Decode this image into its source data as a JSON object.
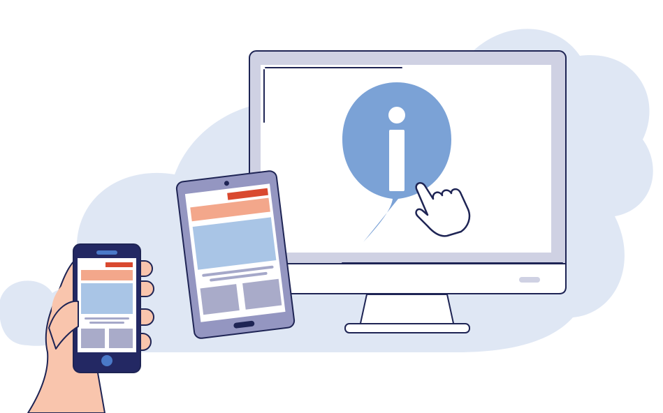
{
  "illustration": {
    "colors": {
      "cloud": "#dfe7f4",
      "outline": "#1e2454",
      "monitor_frame": "#cfd1e3",
      "screen": "#ffffff",
      "info_bubble": "#7ba2d6",
      "tablet_frame": "#9496c1",
      "phone_frame": "#232863",
      "header_red": "#d9492f",
      "header_orange": "#f3a78b",
      "image_block": "#a9c5e6",
      "text_line": "#a5a8c9",
      "thumb": "#a9abc9",
      "skin": "#f9c5ad",
      "accent_blue": "#4a79c8"
    },
    "icons": [
      "cloud-background",
      "desktop-monitor-icon",
      "info-icon",
      "pointing-hand-cursor-icon",
      "tablet-icon",
      "smartphone-icon",
      "hand-holding-phone-icon"
    ]
  }
}
